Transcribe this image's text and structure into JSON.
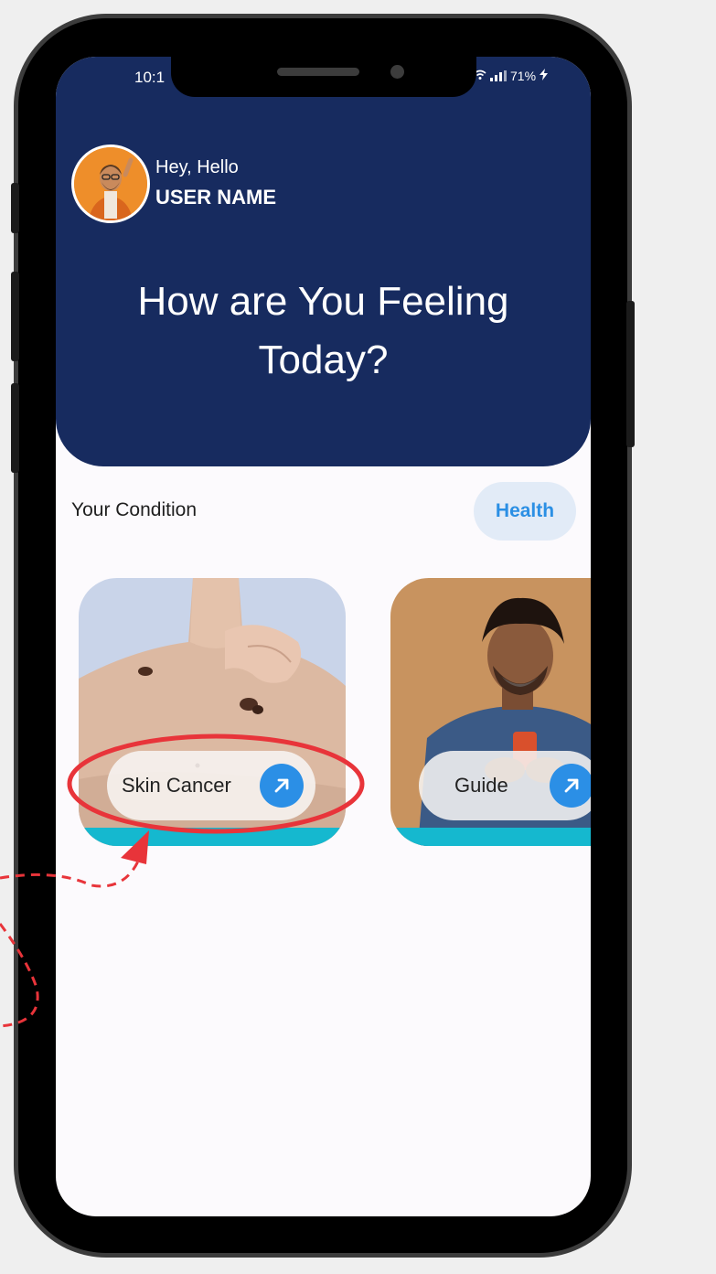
{
  "status_bar": {
    "time": "10:1",
    "battery": "71%"
  },
  "header": {
    "greeting": "Hey, Hello",
    "user_name": "USER NAME",
    "headline_line1": "How are You Feeling",
    "headline_line2": "Today?"
  },
  "section": {
    "title": "Your Condition",
    "filter_label": "Health"
  },
  "cards": [
    {
      "label": "Skin Cancer"
    },
    {
      "label": "Guide"
    }
  ],
  "colors": {
    "header_bg": "#172b5f",
    "accent_blue": "#2b8fe6",
    "teal": "#15b8cf",
    "annotation_red": "#e8343a"
  }
}
